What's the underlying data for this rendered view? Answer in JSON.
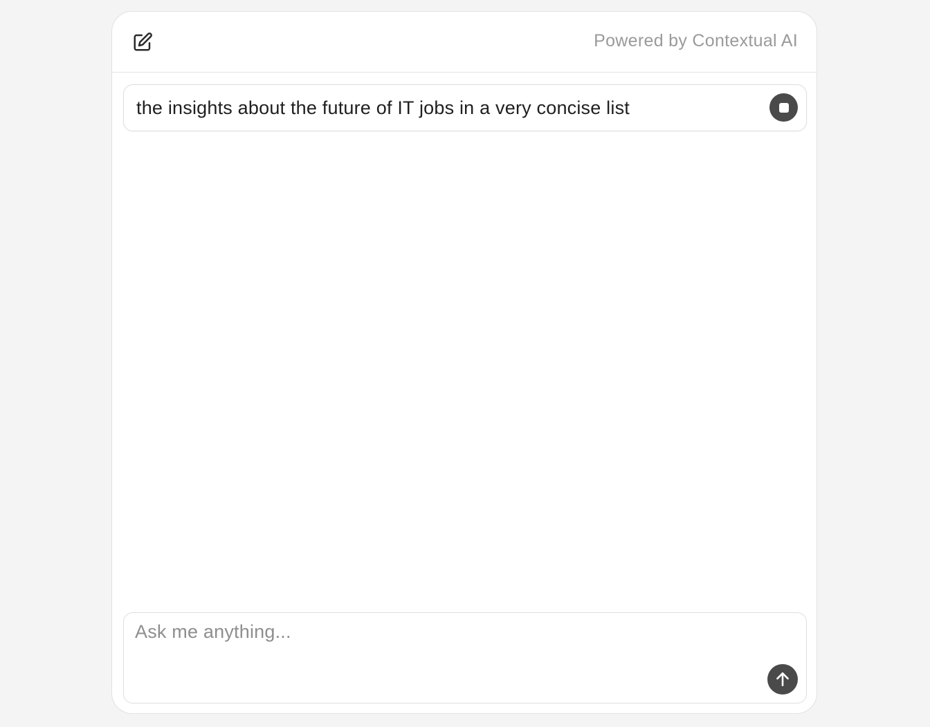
{
  "header": {
    "new_chat_icon": "edit-icon",
    "powered_by": "Powered by Contextual AI"
  },
  "query": {
    "text": "the insights about the future of IT jobs in a very concise list",
    "stop_icon": "stop-icon"
  },
  "composer": {
    "placeholder": "Ask me anything...",
    "value": "",
    "send_icon": "arrow-up-icon"
  },
  "colors": {
    "page_background": "#f4f4f4",
    "panel_background": "#ffffff",
    "button_dark": "#4a4a4a",
    "muted_text": "#9a9a9a"
  }
}
